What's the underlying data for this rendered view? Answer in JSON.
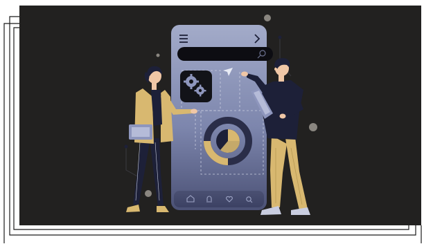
{
  "illustration": {
    "alt": "",
    "colors": {
      "panel_background": "#222120",
      "phone_body_top": "#9aa3c4",
      "phone_body_bottom": "#4e5478",
      "navy": "#1d2038",
      "mustard": "#d8b870",
      "skin": "#f0c7a6",
      "frame_lines": "#1a1a1a"
    },
    "icons": {
      "menu": "hamburger-menu-icon",
      "forward": "chevron-right-icon",
      "search": "search-icon",
      "settings": "gears-icon",
      "home": "home-icon",
      "notifications": "bell-icon",
      "favorites": "heart-icon",
      "search_nav": "search-icon"
    },
    "donut_fill_fraction": 0.25
  }
}
